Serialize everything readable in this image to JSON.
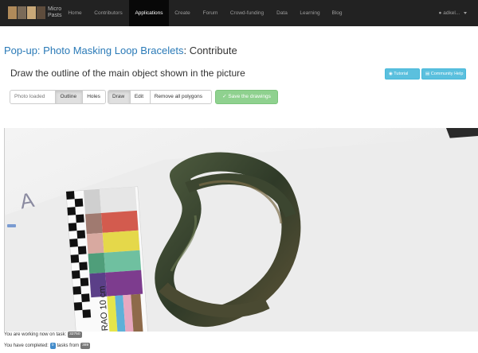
{
  "nav": {
    "brand_text": "Micro Pasts",
    "items": [
      {
        "label": "Home"
      },
      {
        "label": "Contributors"
      },
      {
        "label": "Applications"
      },
      {
        "label": "Create"
      },
      {
        "label": "Forum"
      },
      {
        "label": "Crowd-funding"
      },
      {
        "label": "Data"
      },
      {
        "label": "Learning"
      },
      {
        "label": "Blog"
      }
    ],
    "active": "Applications",
    "user": "adkel..."
  },
  "page": {
    "project_link": "Pop-up: Photo Masking Loop Bracelets",
    "title_suffix": ": Contribute",
    "task_heading": "Draw the outline of the main object shown in the picture"
  },
  "help": {
    "tutorial": "Tutorial",
    "community_help": "Community Help"
  },
  "toolbar": {
    "photo_loaded": "Photo loaded",
    "outline": "Outline",
    "holes": "Holes",
    "draw": "Draw",
    "edit": "Edit",
    "remove_all": "Remove all polygons",
    "save": "Save the drawings"
  },
  "photo": {
    "scale_text": "FRAO 10 cm",
    "letter": "A"
  },
  "status": {
    "working_text": "You are working now on task:",
    "task_id": "32750",
    "completed_text": "You have completed:",
    "completed_count": "0",
    "tasks_from_text": "tasks from",
    "total": "389"
  },
  "colors": {
    "navbar": "#222222",
    "link": "#2a7ab7",
    "info": "#5bc0de",
    "success": "#8fd18f"
  }
}
